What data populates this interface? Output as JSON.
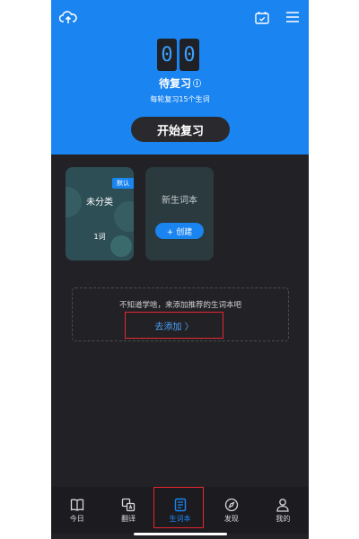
{
  "header": {
    "counter_digits": [
      "0",
      "0"
    ],
    "review_title": "待复习",
    "info_glyph": "ⓘ",
    "review_subtitle": "每轮复习15个生词",
    "start_label": "开始复习",
    "icons": [
      "cloud-upload-icon",
      "calendar-icon",
      "menu-icon"
    ]
  },
  "cards": {
    "default": {
      "tag": "默认",
      "title": "未分类",
      "count": "1词"
    },
    "new": {
      "title": "新生词本",
      "create_label": "+ 创建"
    }
  },
  "recommend": {
    "text": "不知道学啥，来添加推荐的生词本吧",
    "link": "去添加 〉"
  },
  "tabs": [
    {
      "label": "今日",
      "icon": "book-open-icon"
    },
    {
      "label": "翻译",
      "icon": "translate-icon"
    },
    {
      "label": "生词本",
      "icon": "wordbook-icon",
      "active": true
    },
    {
      "label": "发现",
      "icon": "compass-icon"
    },
    {
      "label": "我的",
      "icon": "user-icon"
    }
  ],
  "colors": {
    "accent": "#1a84f0",
    "background": "#222226",
    "highlight": "#e8262e"
  }
}
